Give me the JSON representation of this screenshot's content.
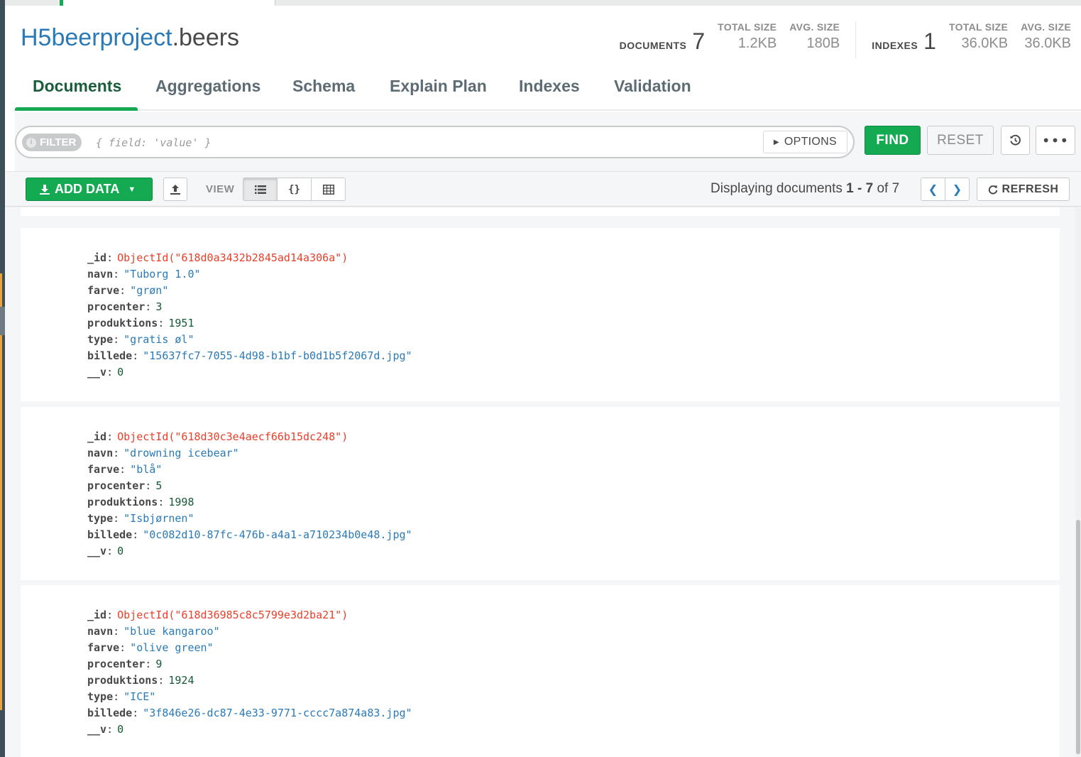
{
  "header": {
    "database": "H5beerproject",
    "collection": ".beers",
    "documents_label": "DOCUMENTS",
    "documents_count": "7",
    "doc_total_size_label": "TOTAL SIZE",
    "doc_total_size": "1.2KB",
    "doc_avg_size_label": "AVG. SIZE",
    "doc_avg_size": "180B",
    "indexes_label": "INDEXES",
    "indexes_count": "1",
    "idx_total_size_label": "TOTAL SIZE",
    "idx_total_size": "36.0KB",
    "idx_avg_size_label": "AVG. SIZE",
    "idx_avg_size": "36.0KB"
  },
  "tabs": [
    {
      "label": "Documents",
      "active": true
    },
    {
      "label": "Aggregations"
    },
    {
      "label": "Schema"
    },
    {
      "label": "Explain Plan"
    },
    {
      "label": "Indexes"
    },
    {
      "label": "Validation"
    }
  ],
  "query": {
    "filter_label": "FILTER",
    "filter_placeholder": "{ field: 'value' }",
    "options_label": "OPTIONS",
    "find_label": "FIND",
    "reset_label": "RESET",
    "more_label": "•••"
  },
  "toolbar": {
    "add_data_label": "ADD DATA",
    "view_label": "VIEW",
    "displaying_prefix": "Displaying documents",
    "range_start": "1",
    "range_dash": "-",
    "range_end": "7",
    "of_word": "of",
    "total": "7",
    "refresh_label": "REFRESH"
  },
  "documents": [
    {
      "fields": [
        {
          "key": "_id",
          "value": "ObjectId(\"618d0a3432b2845ad14a306a\")",
          "kind": "oid"
        },
        {
          "key": "navn",
          "value": "\"Tuborg 1.0\"",
          "kind": "str"
        },
        {
          "key": "farve",
          "value": "\"grøn\"",
          "kind": "str"
        },
        {
          "key": "procenter",
          "value": "3",
          "kind": "num"
        },
        {
          "key": "produktions",
          "value": "1951",
          "kind": "num"
        },
        {
          "key": "type",
          "value": "\"gratis øl\"",
          "kind": "str"
        },
        {
          "key": "billede",
          "value": "\"15637fc7-7055-4d98-b1bf-b0d1b5f2067d.jpg\"",
          "kind": "str"
        },
        {
          "key": "__v",
          "value": "0",
          "kind": "num"
        }
      ]
    },
    {
      "fields": [
        {
          "key": "_id",
          "value": "ObjectId(\"618d30c3e4aecf66b15dc248\")",
          "kind": "oid"
        },
        {
          "key": "navn",
          "value": "\"drowning icebear\"",
          "kind": "str"
        },
        {
          "key": "farve",
          "value": "\"blå\"",
          "kind": "str"
        },
        {
          "key": "procenter",
          "value": "5",
          "kind": "num"
        },
        {
          "key": "produktions",
          "value": "1998",
          "kind": "num"
        },
        {
          "key": "type",
          "value": "\"Isbjørnen\"",
          "kind": "str"
        },
        {
          "key": "billede",
          "value": "\"0c082d10-87fc-476b-a4a1-a710234b0e48.jpg\"",
          "kind": "str"
        },
        {
          "key": "__v",
          "value": "0",
          "kind": "num"
        }
      ]
    },
    {
      "fields": [
        {
          "key": "_id",
          "value": "ObjectId(\"618d36985c8c5799e3d2ba21\")",
          "kind": "oid"
        },
        {
          "key": "navn",
          "value": "\"blue kangaroo\"",
          "kind": "str"
        },
        {
          "key": "farve",
          "value": "\"olive green\"",
          "kind": "str"
        },
        {
          "key": "procenter",
          "value": "9",
          "kind": "num"
        },
        {
          "key": "produktions",
          "value": "1924",
          "kind": "num"
        },
        {
          "key": "type",
          "value": "\"ICE\"",
          "kind": "str"
        },
        {
          "key": "billede",
          "value": "\"3f846e26-dc87-4e33-9771-cccc7a874a83.jpg\"",
          "kind": "str"
        },
        {
          "key": "__v",
          "value": "0",
          "kind": "num"
        }
      ]
    }
  ],
  "colors": {
    "accent_green": "#13aa52",
    "db_blue": "#2a7ab8",
    "objectid_red": "#e8402a",
    "number_green": "#145a32"
  }
}
